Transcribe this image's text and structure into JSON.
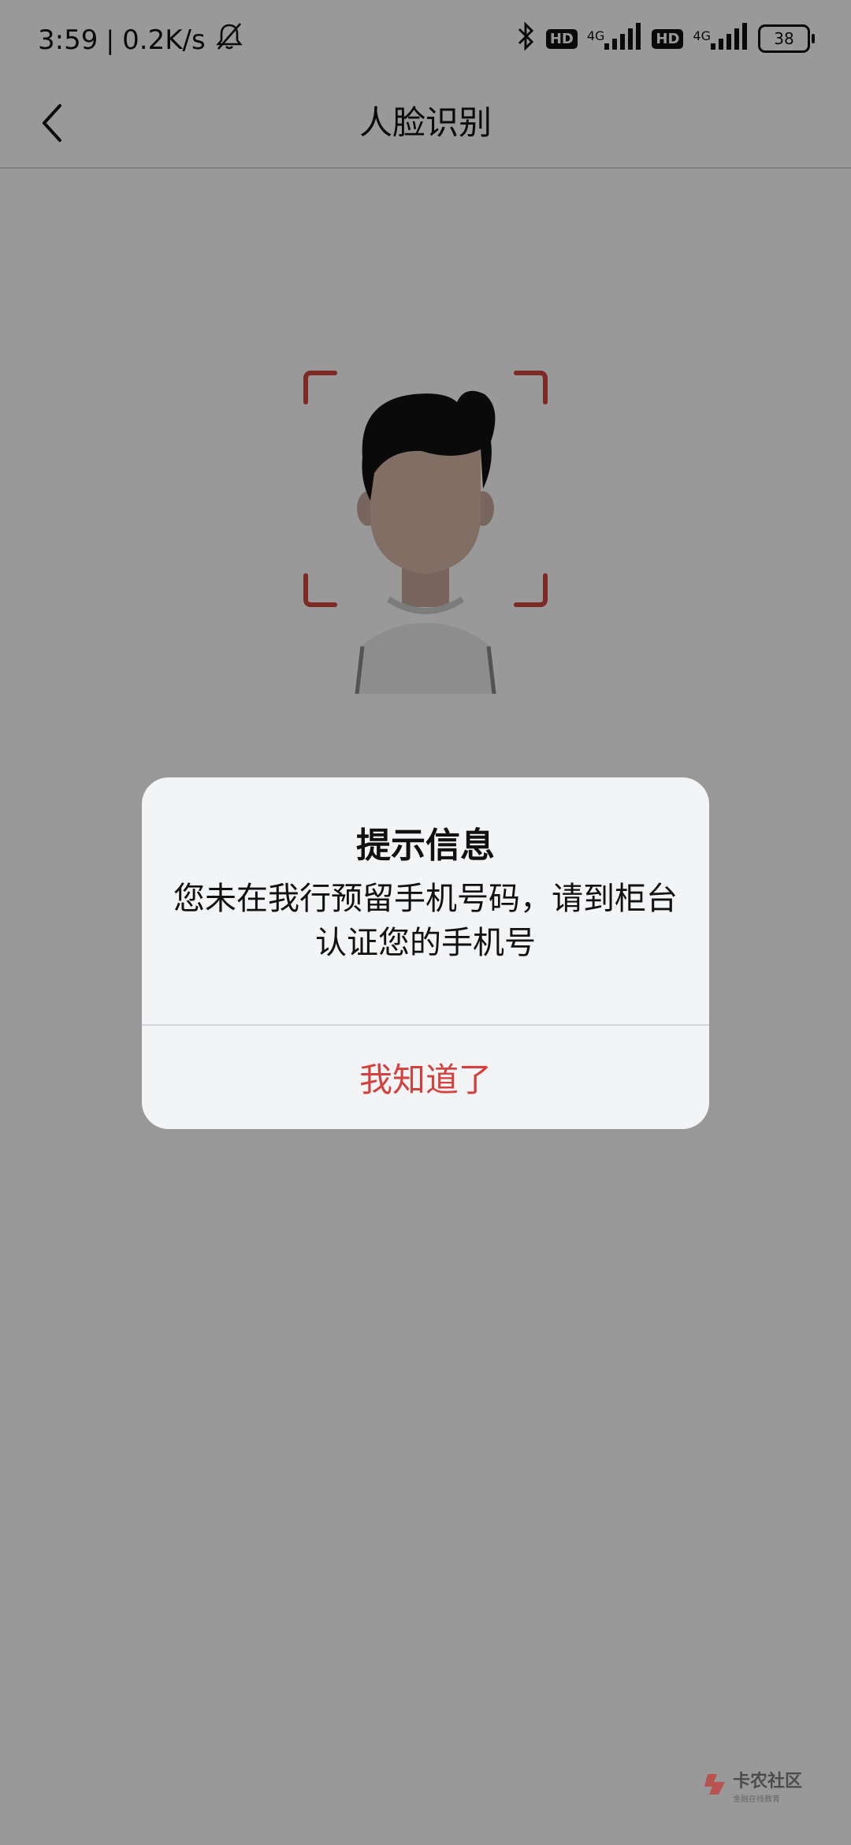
{
  "status_bar": {
    "time": "3:59",
    "speed": "0.2K/s",
    "hd_badge_1": "HD",
    "net_label_1": "4G",
    "hd_badge_2": "HD",
    "net_label_2": "4G",
    "battery": "38"
  },
  "nav": {
    "title": "人脸识别",
    "back_icon": "chevron-left-icon"
  },
  "dialog": {
    "title": "提示信息",
    "message": "您未在我行预留手机号码，请到柜台认证您的手机号",
    "confirm_label": "我知道了"
  },
  "watermark": {
    "name": "卡农社区",
    "sub": "金融在线教育"
  },
  "colors": {
    "accent_red": "#d6403c",
    "frame_red": "#d0463f",
    "overlay": "rgba(0,0,0,0.40)",
    "dialog_bg": "#f3f4f6"
  }
}
